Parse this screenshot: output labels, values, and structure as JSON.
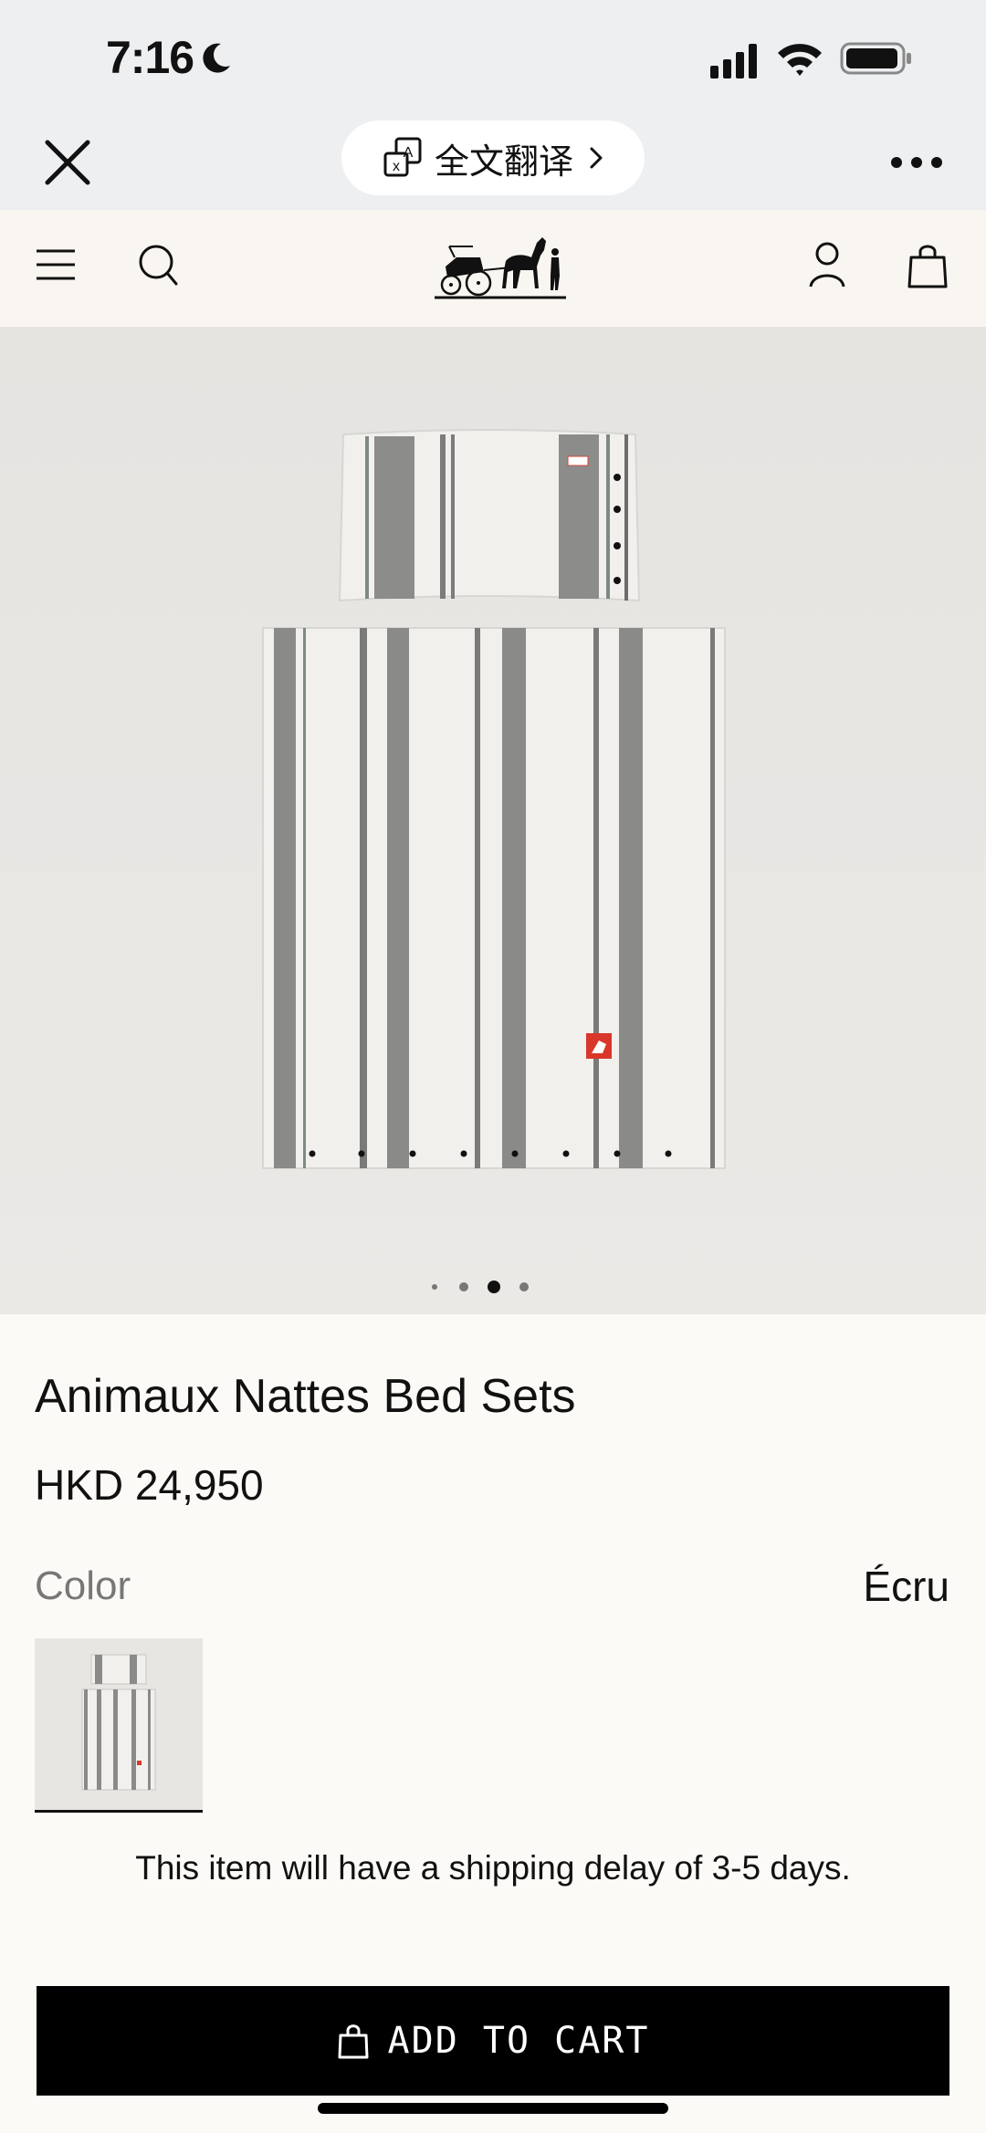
{
  "status_bar": {
    "time": "7:16"
  },
  "browser_bar": {
    "translate_label": "全文翻译"
  },
  "product": {
    "title": "Animaux Nattes Bed Sets",
    "price": "HKD 24,950",
    "color_label": "Color",
    "color_value": "Écru",
    "shipping_note": "This item will have a shipping delay of 3-5 days.",
    "image_count": 4,
    "active_image_index": 3
  },
  "cart": {
    "add_to_cart_label": "ADD TO CART"
  },
  "icons": {
    "close": "close-icon",
    "translate": "translate-icon",
    "more": "more-icon",
    "menu": "menu-icon",
    "search": "search-icon",
    "account": "account-icon",
    "bag": "shopping-bag-icon"
  }
}
